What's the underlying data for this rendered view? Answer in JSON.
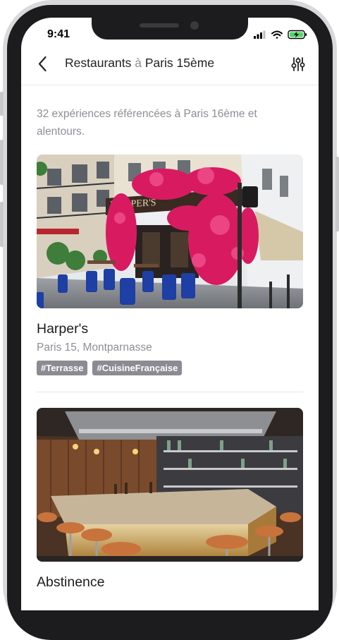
{
  "status_bar": {
    "time": "9:41"
  },
  "header": {
    "title_prefix": "Restaurants ",
    "title_conj": "à",
    "title_city": " Paris 15ème"
  },
  "summary": "32 expériences référencées à Paris 16ème et alentours.",
  "restaurants": [
    {
      "name": "Harper's",
      "location": "Paris 15, Montparnasse",
      "tags": [
        "#Terrasse",
        "#CuisineFrançaise"
      ],
      "sign": "HARPER'S"
    },
    {
      "name": "Abstinence",
      "location": "",
      "tags": []
    }
  ],
  "icons": {
    "back": "chevron-left-icon",
    "filter": "sliders-icon",
    "signal": "cellular-signal-icon",
    "wifi": "wifi-icon",
    "battery": "battery-charging-icon"
  },
  "colors": {
    "tag_bg": "#8b8b93",
    "battery_fill": "#4cd964",
    "muted_text": "#8e8e96",
    "flowers": "#d81b60",
    "chairs": "#1e3fa3"
  }
}
